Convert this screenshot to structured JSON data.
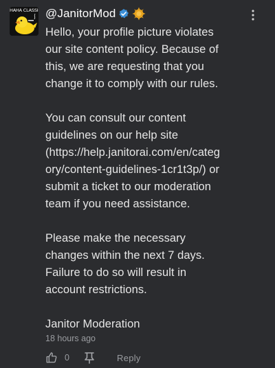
{
  "comment": {
    "avatar_logo_text": "HAHA CLASSIC",
    "author": "@JanitorMod",
    "paragraphs": [
      [
        "Hello, your profile picture violates",
        "our site content policy. Because of",
        "this, we are requesting that you",
        "change it to comply with our rules."
      ],
      [
        "You can consult our content",
        "guidelines on our help site",
        "(https://help.janitorai.com/en/categ",
        "ory/content-guidelines-1cr1t3p/) or",
        "submit a ticket to our moderation",
        "team if you need assistance."
      ],
      [
        "Please make the necessary",
        "changes within the next 7 days.",
        "Failure to do so will result in",
        "account restrictions."
      ],
      [
        "Janitor Moderation"
      ]
    ],
    "timestamp": "18 hours ago",
    "like_count": "0",
    "reply_label": "Reply"
  },
  "colors": {
    "background": "#2b2c2f",
    "text": "#e6e6e6",
    "muted": "#9a9ca0",
    "verified_badge": "#3b8ed6",
    "gold_badge": "#e6a21e",
    "avatar_duck": "#f7d21c"
  },
  "icons": {
    "verified": "verified-badge-icon",
    "gold": "gold-badge-icon",
    "menu": "more-vertical-icon",
    "like": "thumbs-up-icon",
    "dislike": "thumbs-down-icon"
  }
}
